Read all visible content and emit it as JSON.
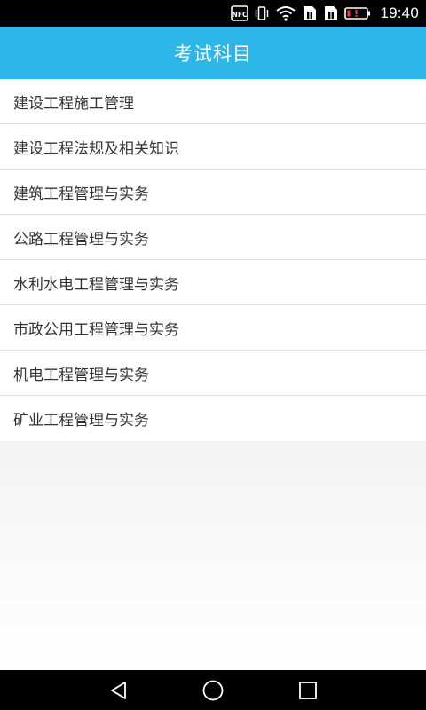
{
  "status_bar": {
    "time": "19:40",
    "icons": [
      "nfc-icon",
      "vibrate-icon",
      "wifi-icon",
      "sim1-icon",
      "sim2-icon",
      "battery-low-icon"
    ],
    "battery_color": "#ff3b3b"
  },
  "header": {
    "title": "考试科目",
    "background": "#2cb7e8"
  },
  "subjects": [
    "建设工程施工管理",
    "建设工程法规及相关知识",
    "建筑工程管理与实务",
    "公路工程管理与实务",
    "水利水电工程管理与实务",
    "市政公用工程管理与实务",
    "机电工程管理与实务",
    "矿业工程管理与实务"
  ],
  "nav_bar": {
    "buttons": [
      "back-icon",
      "home-icon",
      "recent-apps-icon"
    ]
  }
}
